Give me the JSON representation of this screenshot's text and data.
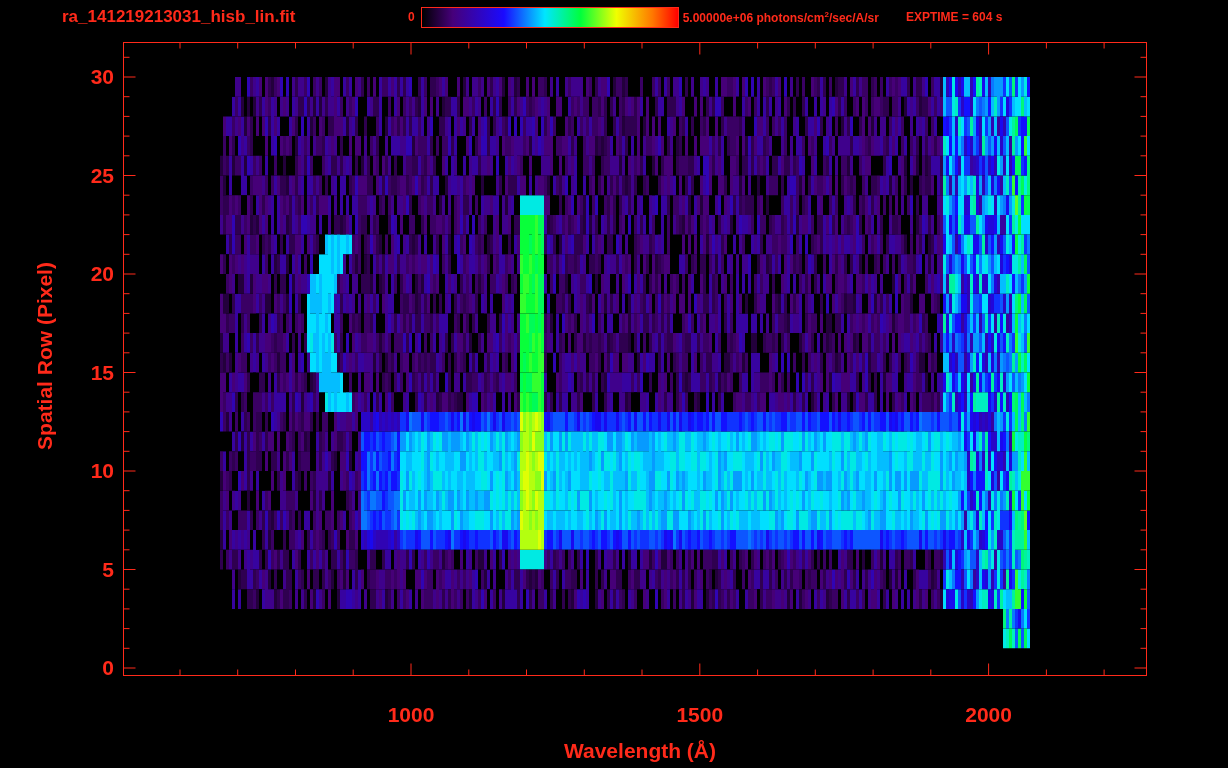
{
  "title": "ra_141219213031_hisb_lin.fit",
  "colorbar": {
    "min_label": "0",
    "max_label": "5.00000e+06 photons/cm$^{2}$/sec/A/sr"
  },
  "exposure": "EXPTIME = 604 s",
  "plot": {
    "xlabel": "Wavelength (Å)",
    "ylabel": "Spatial Row (Pixel)",
    "xtick_labels": [
      "1000",
      "1500",
      "2000"
    ],
    "ytick_labels": [
      "30",
      "25",
      "20",
      "15",
      "10",
      "5",
      "0"
    ]
  }
}
